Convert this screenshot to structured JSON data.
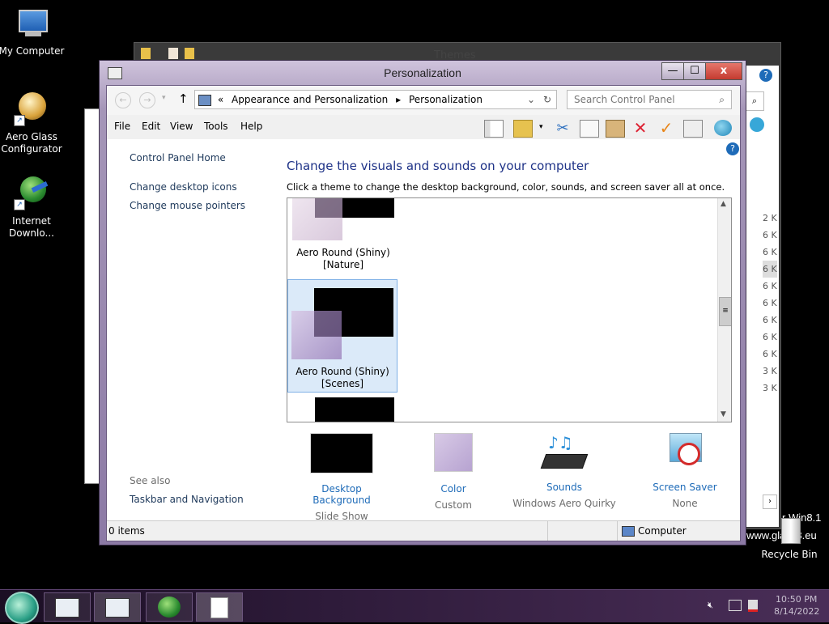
{
  "desktop": {
    "icons": [
      {
        "label": "My Computer"
      },
      {
        "label": "Aero Glass Configurator"
      },
      {
        "label": "Internet Downlo..."
      },
      {
        "label": "Recycle Bin"
      }
    ],
    "watermark_line1": "r Win8.1",
    "watermark_line2": "www.glass8.eu"
  },
  "background_window": {
    "title": "Themes",
    "sizes": [
      "2 K",
      "6 K",
      "6 K",
      "6 K",
      "6 K",
      "6 K",
      "6 K",
      "6 K",
      "6 K",
      "3 K",
      "3 K"
    ]
  },
  "window": {
    "title": "Personalization",
    "controls": {
      "minimize": "—",
      "maximize": "☐",
      "close": "x"
    },
    "address": {
      "prefix": "«",
      "crumb1": "Appearance and Personalization",
      "sep": "▸",
      "crumb2": "Personalization",
      "dropdown": "⌄",
      "refresh": "↻"
    },
    "search_placeholder": "Search Control Panel",
    "menu": [
      "File",
      "Edit",
      "View",
      "Tools",
      "Help"
    ],
    "sidebar": {
      "home": "Control Panel Home",
      "links": [
        "Change desktop icons",
        "Change mouse pointers"
      ],
      "see_also": "See also",
      "see_also_links": [
        "Taskbar and Navigation"
      ]
    },
    "heading": "Change the visuals and sounds on your computer",
    "subheading": "Click a theme to change the desktop background, color, sounds, and screen saver all at once.",
    "themes": [
      {
        "name_line1": "Aero Round (Shiny)",
        "name_line2": "[Nature]"
      },
      {
        "name_line1": "Aero Round (Shiny)",
        "name_line2": "[Scenes]"
      }
    ],
    "bottom": [
      {
        "label": "Desktop Background",
        "value": "Slide Show"
      },
      {
        "label": "Color",
        "value": "Custom"
      },
      {
        "label": "Sounds",
        "value": "Windows Aero Quirky"
      },
      {
        "label": "Screen Saver",
        "value": "None"
      }
    ],
    "status": {
      "items": "0 items",
      "location": "Computer"
    }
  },
  "taskbar": {
    "time": "10:50 PM",
    "date": "8/14/2022"
  },
  "colors": {
    "accent": "#1e6bb8",
    "selection": "#dbeaf9",
    "taskbar": "#2e1b3a",
    "window_frame": "#8c7aa5"
  }
}
